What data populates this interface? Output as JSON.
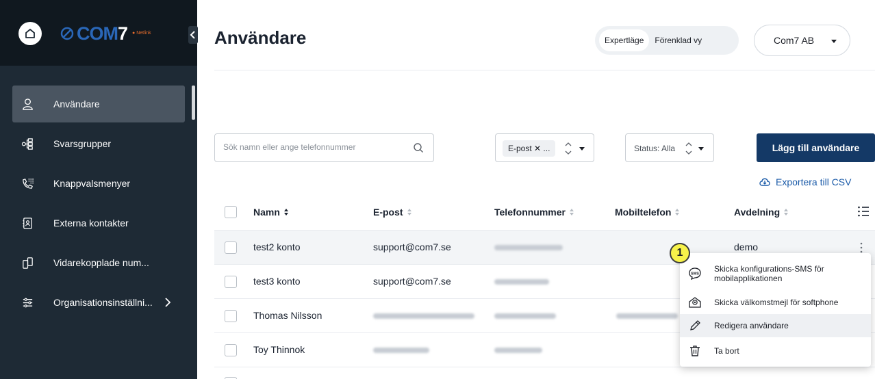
{
  "sidebar": {
    "logo": {
      "brand": "COM7",
      "subtitle": "Netlink"
    },
    "items": [
      {
        "label": "Användare",
        "icon": "user-icon",
        "active": true
      },
      {
        "label": "Svarsgrupper",
        "icon": "group-tree-icon"
      },
      {
        "label": "Knappvalsmenyer",
        "icon": "phone-keypad-icon"
      },
      {
        "label": "Externa kontakter",
        "icon": "contact-card-icon"
      },
      {
        "label": "Vidarekopplade num...",
        "icon": "forwarded-phone-icon"
      },
      {
        "label": "Organisationsinställni...",
        "icon": "settings-list-icon",
        "has_submenu": true
      }
    ]
  },
  "header": {
    "title": "Användare",
    "view_toggle": {
      "expert": "Expertläge",
      "simple": "Förenklad vy",
      "selected": "expert"
    },
    "organization": "Com7 AB"
  },
  "toolbar": {
    "search_placeholder": "Sök namn eller ange telefonnummer",
    "filter_chip": "E-post ✕ ...",
    "status_filter": "Status: Alla",
    "add_button": "Lägg till användare",
    "export_link": "Exportera till CSV"
  },
  "table": {
    "columns": [
      "Namn",
      "E-post",
      "Telefonnummer",
      "Mobiltelefon",
      "Avdelning"
    ],
    "rows": [
      {
        "name": "test2 konto",
        "email": "support@com7.se",
        "phone": "blurred",
        "mobile": "",
        "department": "demo"
      },
      {
        "name": "test3 konto",
        "email": "support@com7.se",
        "phone": "blurred",
        "mobile": "",
        "department": ""
      },
      {
        "name": "Thomas Nilsson",
        "email": "blurred",
        "phone": "blurred",
        "mobile": "blurred",
        "department": ""
      },
      {
        "name": "Toy Thinnok",
        "email": "blurred",
        "phone": "blurred",
        "mobile": "",
        "department": ""
      }
    ]
  },
  "context_menu": {
    "badge": "1",
    "items": [
      {
        "label_line1": "Skicka konfigurations-SMS för",
        "label_line2": "mobilapplikationen",
        "icon": "sms-icon"
      },
      {
        "label": "Skicka välkomstmejl för softphone",
        "icon": "envelope-at-icon"
      },
      {
        "label": "Redigera användare",
        "icon": "pencil-icon",
        "highlighted": true
      },
      {
        "label": "Ta bort",
        "icon": "trash-icon"
      }
    ]
  },
  "colors": {
    "sidebar_bg": "#1e2a35",
    "primary": "#143966",
    "link": "#1a5aa8",
    "badge": "#f7f24a"
  }
}
